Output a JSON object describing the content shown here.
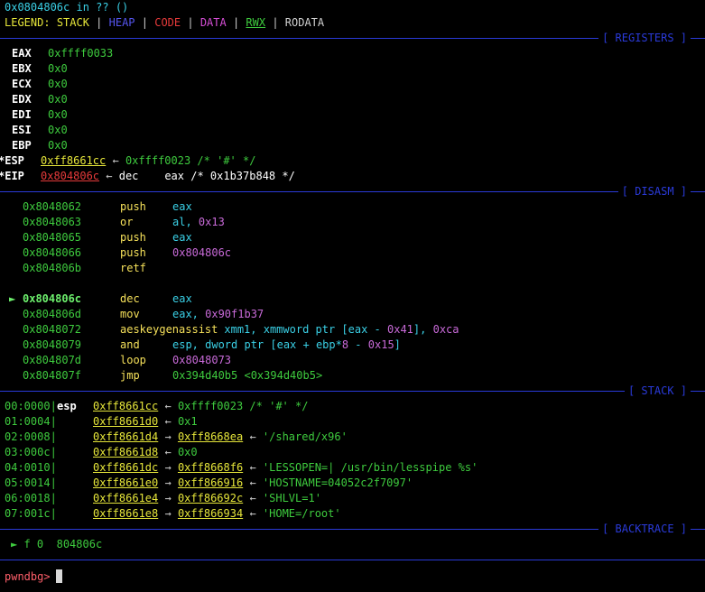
{
  "header": {
    "location_addr": "0x0804806c",
    "location_rest": " in ?? ()"
  },
  "legend": {
    "label": "LEGEND:",
    "items": [
      {
        "text": "STACK",
        "color": "#e6e63a"
      },
      {
        "text": "HEAP",
        "color": "#55e"
      },
      {
        "text": "CODE",
        "color": "#e63a3a"
      },
      {
        "text": "DATA",
        "color": "#d64ed6"
      },
      {
        "text": "RWX",
        "color": "#3ecb3e"
      },
      {
        "text": "RODATA",
        "color": "#d0d0d0"
      }
    ],
    "sep": " | "
  },
  "sections": {
    "registers": "[ REGISTERS ]",
    "disasm": "[ DISASM ]",
    "stack": "[ STACK ]",
    "backtrace": "[ BACKTRACE ]"
  },
  "registers": [
    {
      "name": "EAX",
      "value": "0xffff0033"
    },
    {
      "name": "EBX",
      "value": "0x0"
    },
    {
      "name": "ECX",
      "value": "0x0"
    },
    {
      "name": "EDX",
      "value": "0x0"
    },
    {
      "name": "EDI",
      "value": "0x0"
    },
    {
      "name": "ESI",
      "value": "0x0"
    },
    {
      "name": "EBP",
      "value": "0x0"
    }
  ],
  "esp": {
    "name": "*ESP",
    "value": "0xff8661cc",
    "arrow": "←",
    "deref": "0xffff0023 /* '#' */"
  },
  "eip": {
    "name": "*EIP",
    "value": "0x804806c",
    "arrow": "←",
    "mnemonic": "dec",
    "operands": "eax /* 0x1b37b848 */"
  },
  "disasm": {
    "before": [
      {
        "addr": "0x8048062",
        "mn": "push",
        "ops": "eax"
      },
      {
        "addr": "0x8048063",
        "mn": "or",
        "ops_reg": "al, ",
        "ops_imm": "0x13"
      },
      {
        "addr": "0x8048065",
        "mn": "push",
        "ops": "eax"
      },
      {
        "addr": "0x8048066",
        "mn": "push",
        "ops_imm": "0x804806c"
      },
      {
        "addr": "0x804806b",
        "mn": "retf"
      }
    ],
    "marker": "►",
    "current": {
      "addr": "0x804806c",
      "mn": "dec",
      "ops": "eax"
    },
    "after": [
      {
        "addr": "0x804806d",
        "mn": "mov",
        "ops_reg": "eax, ",
        "ops_imm": "0x90f1b37"
      },
      {
        "addr": "0x8048072",
        "mn": "aeskeygenassist",
        "ops_a": "xmm1, xmmword ptr [eax - ",
        "ops_b": "0x41",
        "ops_c": "], ",
        "ops_d": "0xca"
      },
      {
        "addr": "0x8048079",
        "mn": "and",
        "ops_a": "esp, dword ptr [eax + ebp*",
        "ops_b": "8",
        "ops_c": " - ",
        "ops_d": "0x15",
        "ops_e": "]"
      },
      {
        "addr": "0x804807d",
        "mn": "loop",
        "ops_addr": "0x8048073"
      },
      {
        "addr": "0x804807f",
        "mn": "jmp",
        "ops_addr": "0x394d40b5 <0x394d40b5>"
      }
    ]
  },
  "stack": [
    {
      "off": "00:0000|",
      "reg": "esp",
      "addr": "0xff8661cc",
      "arrow1": "←",
      "val": "0xffff0023 /* '#' */"
    },
    {
      "off": "01:0004|",
      "reg": "",
      "addr": "0xff8661d0",
      "arrow1": "←",
      "val": "0x1"
    },
    {
      "off": "02:0008|",
      "reg": "",
      "addr": "0xff8661d4",
      "arrow1": "→",
      "ptr": "0xff8668ea",
      "arrow2": "←",
      "val": "'/shared/x96'"
    },
    {
      "off": "03:000c|",
      "reg": "",
      "addr": "0xff8661d8",
      "arrow1": "←",
      "val": "0x0"
    },
    {
      "off": "04:0010|",
      "reg": "",
      "addr": "0xff8661dc",
      "arrow1": "→",
      "ptr": "0xff8668f6",
      "arrow2": "←",
      "val": "'LESSOPEN=| /usr/bin/lesspipe %s'"
    },
    {
      "off": "05:0014|",
      "reg": "",
      "addr": "0xff8661e0",
      "arrow1": "→",
      "ptr": "0xff866916",
      "arrow2": "←",
      "val": "'HOSTNAME=04052c2f7097'"
    },
    {
      "off": "06:0018|",
      "reg": "",
      "addr": "0xff8661e4",
      "arrow1": "→",
      "ptr": "0xff86692c",
      "arrow2": "←",
      "val": "'SHLVL=1'"
    },
    {
      "off": "07:001c|",
      "reg": "",
      "addr": "0xff8661e8",
      "arrow1": "→",
      "ptr": "0xff866934",
      "arrow2": "←",
      "val": "'HOME=/root'"
    }
  ],
  "backtrace": {
    "marker": "►",
    "frame": "f 0",
    "addr": "804806c"
  },
  "prompt": {
    "text": "pwndbg>"
  }
}
